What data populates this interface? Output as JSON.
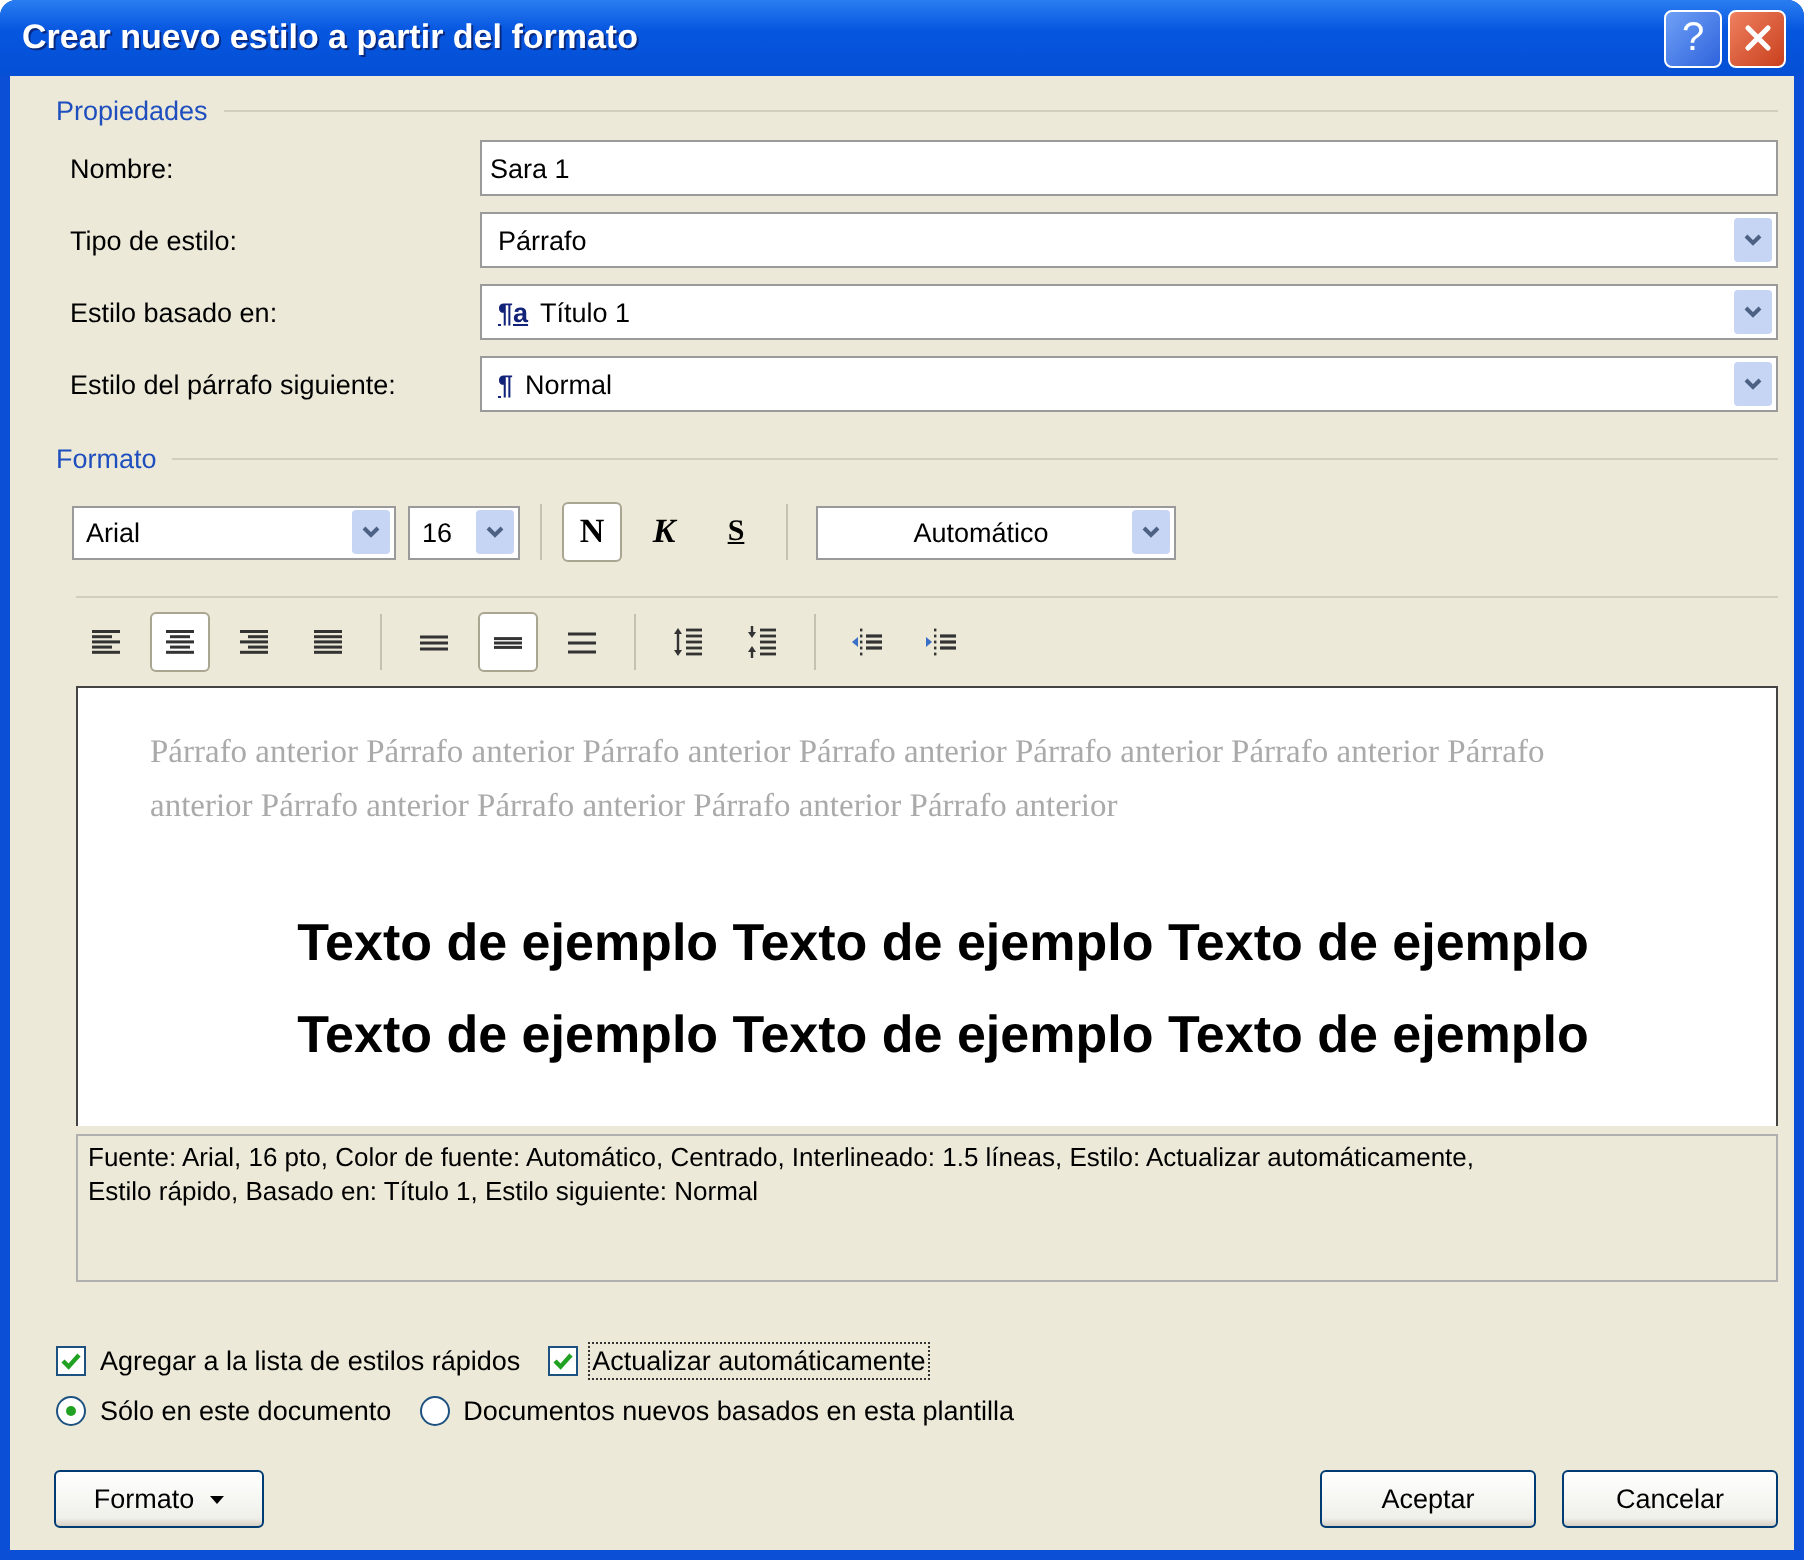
{
  "window": {
    "title": "Crear nuevo estilo a partir del formato",
    "help_button": "?"
  },
  "properties": {
    "heading": "Propiedades",
    "rows": [
      {
        "label": "Nombre:",
        "kind": "text",
        "value": "Sara 1"
      },
      {
        "label": "Tipo de estilo:",
        "kind": "select",
        "value": "Párrafo"
      },
      {
        "label": "Estilo basado en:",
        "kind": "select",
        "glyph": "¶a",
        "value": "Título 1"
      },
      {
        "label": "Estilo del párrafo siguiente:",
        "kind": "select",
        "glyph": "¶",
        "value": "Normal"
      }
    ]
  },
  "format": {
    "heading": "Formato",
    "font": "Arial",
    "size": "16",
    "font_color_setting": "Automático",
    "text_styles": [
      {
        "label": "N",
        "kind": "bold",
        "selected": true
      },
      {
        "label": "K",
        "kind": "italic",
        "selected": false
      },
      {
        "label": "S",
        "kind": "underline",
        "selected": false
      }
    ],
    "alignment": [
      {
        "kind": "left",
        "selected": false
      },
      {
        "kind": "center",
        "selected": true
      },
      {
        "kind": "right",
        "selected": false
      },
      {
        "kind": "justify",
        "selected": false
      }
    ],
    "line_spacing": [
      {
        "kind": "single",
        "selected": false
      },
      {
        "kind": "one_half",
        "selected": true
      },
      {
        "kind": "double",
        "selected": false
      }
    ],
    "paragraph_spacing": [
      {
        "kind": "increase"
      },
      {
        "kind": "decrease"
      }
    ],
    "indent": [
      {
        "kind": "decrease"
      },
      {
        "kind": "increase"
      }
    ]
  },
  "preview": {
    "previous_paragraph": "Párrafo anterior Párrafo anterior Párrafo anterior Párrafo anterior Párrafo anterior Párrafo anterior Párrafo anterior Párrafo anterior Párrafo anterior Párrafo anterior Párrafo anterior",
    "sample_lines": [
      "Texto de ejemplo Texto de ejemplo Texto de ejemplo",
      "Texto de ejemplo Texto de ejemplo Texto de ejemplo"
    ]
  },
  "description": "Fuente: Arial, 16 pto, Color de fuente: Automático, Centrado, Interlineado:  1.5 líneas, Estilo: Actualizar automáticamente, Estilo rápido, Basado en: Título 1, Estilo siguiente: Normal",
  "checkboxes": [
    {
      "label": "Agregar a la lista de estilos rápidos",
      "checked": true,
      "focused": false
    },
    {
      "label": "Actualizar automáticamente",
      "checked": true,
      "focused": true
    }
  ],
  "radios": [
    {
      "label": "Sólo en este documento",
      "selected": true
    },
    {
      "label": "Documentos nuevos basados en esta plantilla",
      "selected": false
    }
  ],
  "format_button": "Formato",
  "buttons": [
    "Aceptar",
    "Cancelar"
  ]
}
